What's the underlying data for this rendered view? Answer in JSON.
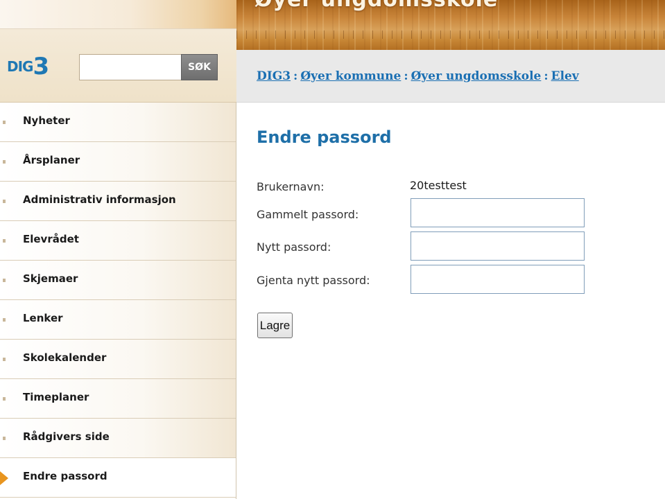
{
  "header": {
    "banner_title": "Øyer ungdomsskole"
  },
  "brand": {
    "logo_prefix": "DIG",
    "logo_suffix": "3"
  },
  "search": {
    "value": "",
    "button_label": "SØK"
  },
  "breadcrumb": {
    "items": [
      "DIG3",
      "Øyer kommune",
      "Øyer ungdomsskole",
      "Elev"
    ],
    "separator": ":"
  },
  "sidebar": {
    "items": [
      {
        "label": "Nyheter"
      },
      {
        "label": "Årsplaner"
      },
      {
        "label": "Administrativ informasjon"
      },
      {
        "label": "Elevrådet"
      },
      {
        "label": "Skjemaer"
      },
      {
        "label": "Lenker"
      },
      {
        "label": "Skolekalender"
      },
      {
        "label": "Timeplaner"
      },
      {
        "label": "Rådgivers side"
      },
      {
        "label": "Endre passord"
      }
    ],
    "active_index": 9
  },
  "main": {
    "title": "Endre passord",
    "form": {
      "username_label": "Brukernavn:",
      "username_value": "20testtest",
      "old_password_label": "Gammelt passord:",
      "old_password_value": "",
      "new_password_label": "Nytt passord:",
      "new_password_value": "",
      "repeat_password_label": "Gjenta nytt passord:",
      "repeat_password_value": "",
      "save_label": "Lagre"
    }
  },
  "colors": {
    "link_blue": "#1a6fb3",
    "title_blue": "#1e6fa8",
    "active_marker": "#e8951f",
    "banner_orange": "#c9853a"
  }
}
